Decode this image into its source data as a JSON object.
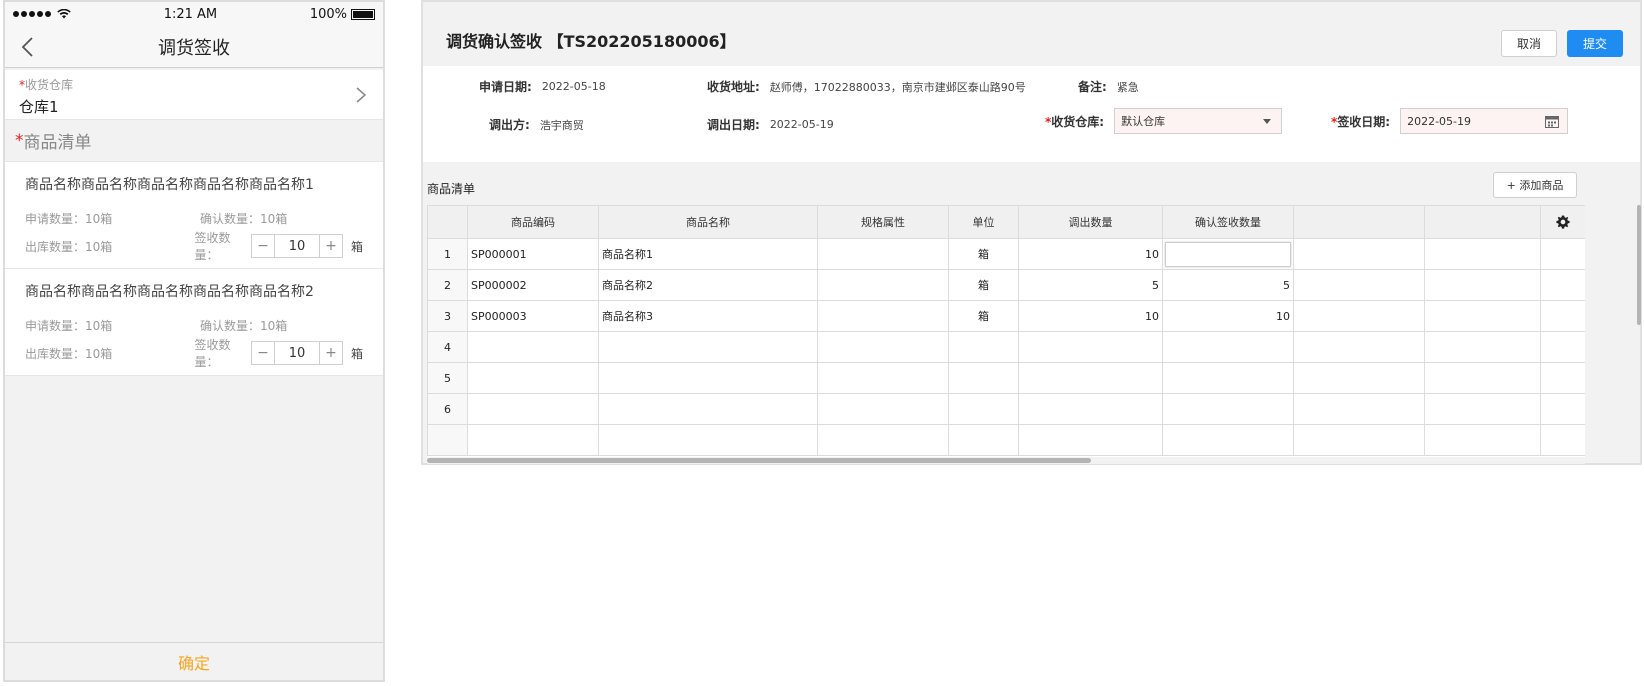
{
  "mobile": {
    "status": {
      "time": "1:21 AM",
      "battery": "100%"
    },
    "nav": {
      "title": "调货签收"
    },
    "warehouse": {
      "label": "收货仓库",
      "required": "*",
      "value": "仓库1"
    },
    "list_title": "商品清单",
    "list_required": "*",
    "items": [
      {
        "name": "商品名称商品名称商品名称商品名称商品名称1",
        "apply": "申请数量：10箱",
        "confirm": "确认数量：10箱",
        "out": "出库数量：10箱",
        "sign_label": "签收数量：",
        "minus": "−",
        "qty": "10",
        "plus": "+",
        "unit": "箱"
      },
      {
        "name": "商品名称商品名称商品名称商品名称商品名称2",
        "apply": "申请数量：10箱",
        "confirm": "确认数量：10箱",
        "out": "出库数量：10箱",
        "sign_label": "签收数量：",
        "minus": "−",
        "qty": "10",
        "plus": "+",
        "unit": "箱"
      }
    ],
    "confirm_label": "确定",
    "accent": "#f5a623"
  },
  "desktop": {
    "title": "调货确认签收 【TS202205180006】",
    "cancel_label": "取消",
    "submit_label": "提交",
    "form": {
      "apply_date_label": "申请日期:",
      "apply_date": "2022-05-18",
      "address_label": "收货地址:",
      "address": "赵师傅，17022880033，南京市建邺区泰山路90号",
      "remark_label": "备注:",
      "remark": "紧急",
      "out_party_label": "调出方:",
      "out_party": "浩宇商贸",
      "out_date_label": "调出日期:",
      "out_date": "2022-05-19",
      "warehouse_label": "收货仓库:",
      "warehouse": "默认仓库",
      "sign_date_label": "签收日期:",
      "sign_date": "2022-05-19",
      "required": "*"
    },
    "list_title": "商品清单",
    "add_label": "+ 添加商品",
    "columns": [
      "",
      "商品编码",
      "商品名称",
      "规格属性",
      "单位",
      "调出数量",
      "确认签收数量",
      "",
      ""
    ],
    "rows": [
      {
        "idx": "1",
        "code": "SP000001",
        "name": "商品名称1",
        "spec": "",
        "unit": "箱",
        "out_qty": "10",
        "sign_qty": ""
      },
      {
        "idx": "2",
        "code": "SP000002",
        "name": "商品名称2",
        "spec": "",
        "unit": "箱",
        "out_qty": "5",
        "sign_qty": "5"
      },
      {
        "idx": "3",
        "code": "SP000003",
        "name": "商品名称3",
        "spec": "",
        "unit": "箱",
        "out_qty": "10",
        "sign_qty": "10"
      },
      {
        "idx": "4",
        "code": "",
        "name": "",
        "spec": "",
        "unit": "",
        "out_qty": "",
        "sign_qty": ""
      },
      {
        "idx": "5",
        "code": "",
        "name": "",
        "spec": "",
        "unit": "",
        "out_qty": "",
        "sign_qty": ""
      },
      {
        "idx": "6",
        "code": "",
        "name": "",
        "spec": "",
        "unit": "",
        "out_qty": "",
        "sign_qty": ""
      },
      {
        "idx": "",
        "code": "",
        "name": "",
        "spec": "",
        "unit": "",
        "out_qty": "",
        "sign_qty": ""
      }
    ],
    "primary_color": "#1e8cf0",
    "icons": {
      "settings": "gear-icon",
      "calendar": "calendar-icon",
      "dropdown": "chevron-down-icon"
    }
  }
}
